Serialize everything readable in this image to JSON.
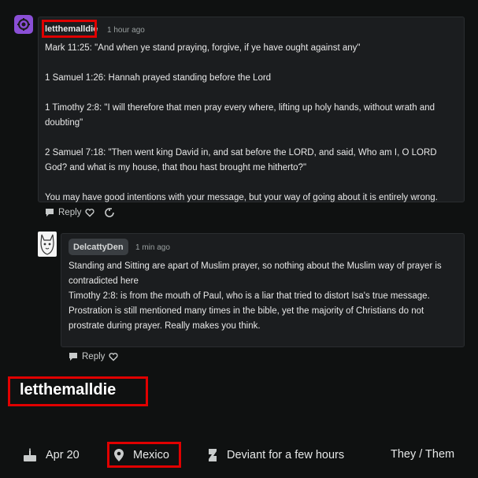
{
  "comment1": {
    "username": "letthemalldie",
    "time": "1 hour ago",
    "paragraphs": [
      "Mark 11:25: \"And when ye stand praying, forgive, if ye have ought against any\"",
      "1 Samuel 1:26: Hannah prayed standing before the Lord",
      "1 Timothy 2:8: \"I will therefore that men pray every where, lifting up holy hands, without wrath and doubting\"",
      "2 Samuel 7:18: \"Then went king David in, and sat before the LORD, and said, Who am I, O LORD God? and what is my house, that thou hast brought me hitherto?\"",
      "You may have good intentions with your message, but your way of going about it is entirely wrong."
    ],
    "reply_label": "Reply"
  },
  "comment2": {
    "username": "DelcattyDen",
    "time": "1 min ago",
    "lines": [
      "Standing and Sitting are apart of Muslim prayer, so nothing about the Muslim way of prayer is contradicted here",
      "Timothy 2:8: is from the mouth of Paul, who is a liar that tried to distort Isa's true message.",
      "Prostration is still mentioned many times in the bible, yet the majority of Christians do not prostrate during prayer. Really makes you think."
    ],
    "reply_label": "Reply"
  },
  "profile": {
    "username": "letthemalldie",
    "birthday": "Apr 20",
    "location": "Mexico",
    "deviant_for": "Deviant for a few hours",
    "pronouns": "They / Them"
  },
  "colors": {
    "highlight": "#e00000",
    "avatar_purple": "#8a4fd6"
  }
}
